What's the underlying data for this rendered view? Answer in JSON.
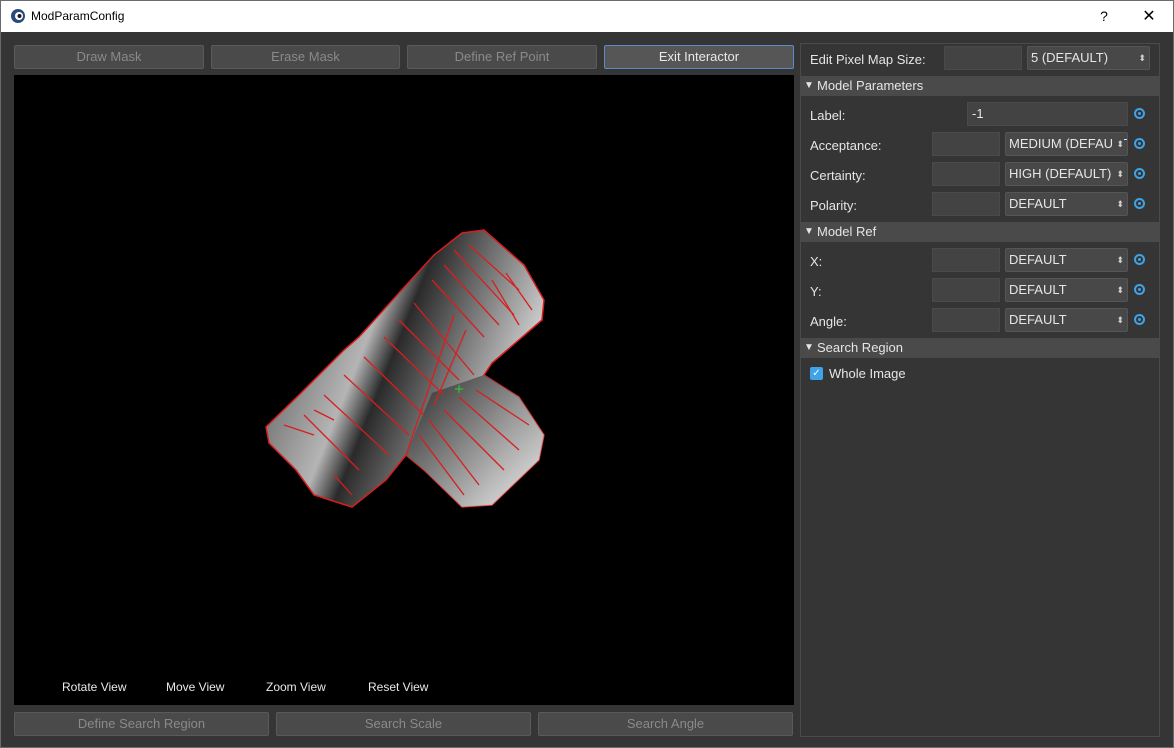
{
  "window": {
    "title": "ModParamConfig",
    "help_label": "?",
    "close_label": "✕"
  },
  "toolbar": {
    "draw_mask": "Draw Mask",
    "erase_mask": "Erase Mask",
    "define_ref_point": "Define Ref Point",
    "exit_interactor": "Exit Interactor"
  },
  "view_controls": {
    "rotate": "Rotate View",
    "move": "Move View",
    "zoom": "Zoom View",
    "reset": "Reset View"
  },
  "bottom_buttons": {
    "define_search_region": "Define Search Region",
    "search_scale": "Search Scale",
    "search_angle": "Search Angle"
  },
  "panel": {
    "pixel_map": {
      "label": "Edit Pixel Map Size:",
      "value": "",
      "option": "5 (DEFAULT)"
    },
    "model_parameters": {
      "title": "Model Parameters",
      "label": {
        "label": "Label:",
        "value": "-1"
      },
      "acceptance": {
        "label": "Acceptance:",
        "value": "",
        "option": "MEDIUM (DEFAULT)"
      },
      "certainty": {
        "label": "Certainty:",
        "value": "",
        "option": "HIGH (DEFAULT)"
      },
      "polarity": {
        "label": "Polarity:",
        "value": "",
        "option": "DEFAULT"
      }
    },
    "model_ref": {
      "title": "Model Ref",
      "x": {
        "label": "X:",
        "value": "",
        "option": "DEFAULT"
      },
      "y": {
        "label": "Y:",
        "value": "",
        "option": "DEFAULT"
      },
      "angle": {
        "label": "Angle:",
        "value": "",
        "option": "DEFAULT"
      }
    },
    "search_region": {
      "title": "Search Region",
      "whole_image": {
        "label": "Whole Image",
        "checked": true
      }
    }
  },
  "icons": {
    "collapse": "▼",
    "combo_arrows": "⬍",
    "check": "✓"
  },
  "colors": {
    "accent": "#3ea3e8",
    "edge": "#d81e1e",
    "ref_marker": "#29d629"
  }
}
